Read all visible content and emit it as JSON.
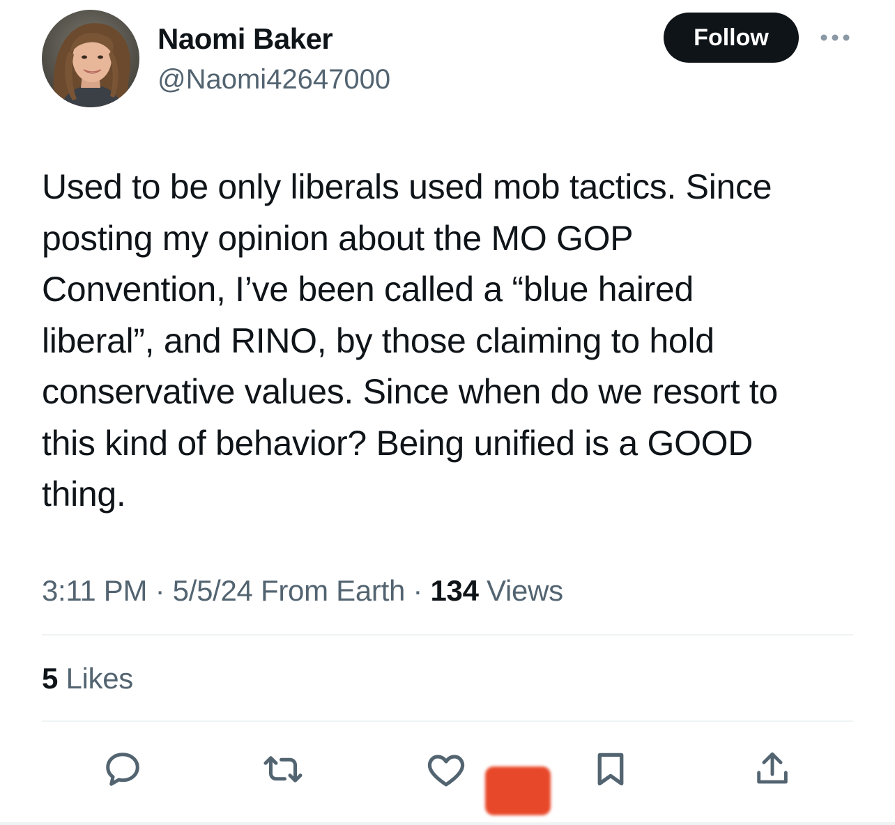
{
  "author": {
    "display_name": "Naomi Baker",
    "handle": "@Naomi42647000"
  },
  "header": {
    "follow_label": "Follow",
    "more_icon": "ellipsis-icon"
  },
  "tweet": {
    "text": "Used to be only liberals used mob tactics. Since\nposting my opinion about the MO GOP\nConvention, I’ve been called a “blue haired\nliberal”, and RINO, by those claiming to hold\nconservative values. Since when do we resort to\nthis kind of behavior? Being unified is a GOOD\nthing."
  },
  "meta": {
    "time": "3:11 PM",
    "separator": " · ",
    "date": "5/5/24",
    "location": "From Earth",
    "views_count": "134",
    "views_label": "Views"
  },
  "stats": {
    "likes_count": "5",
    "likes_label": "Likes"
  },
  "actions": {
    "icons": [
      "reply-icon",
      "retweet-icon",
      "like-icon",
      "bookmark-icon",
      "share-icon"
    ]
  },
  "colors": {
    "text_primary": "#0f1419",
    "text_secondary": "#536471",
    "divider": "#eff3f4",
    "follow_bg": "#0f1419",
    "redaction": "#e8482a"
  }
}
